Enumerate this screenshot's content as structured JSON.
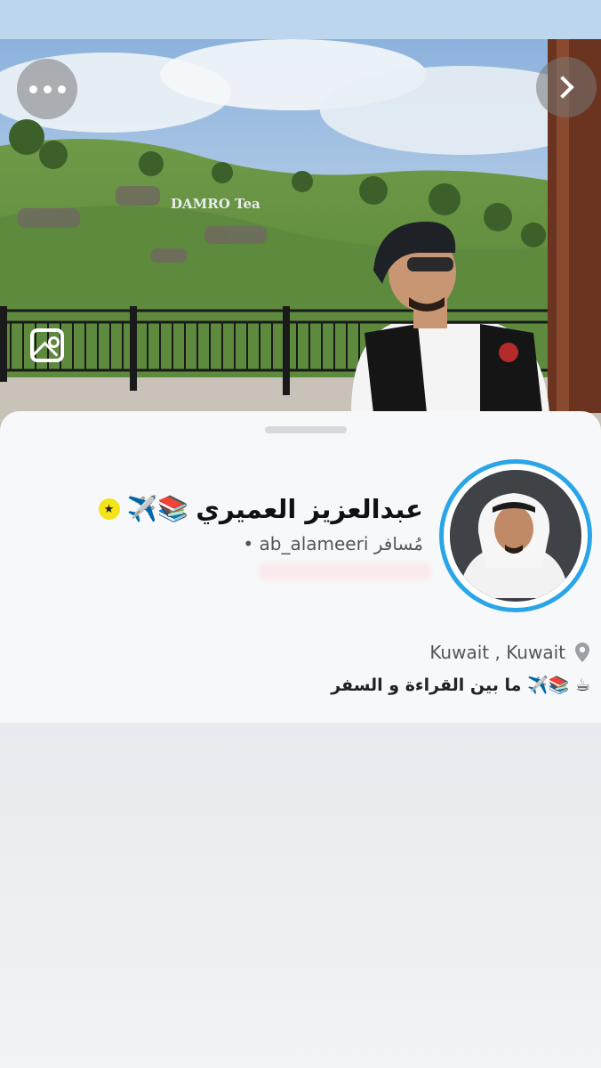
{
  "profile": {
    "display_name": "عبدالعزيز العميري",
    "name_emojis": "✈️📚",
    "star_badge_icon": "★",
    "username_line": "• ab_alameeri مُسافر",
    "location": "Kuwait , Kuwait",
    "bio": "ما بين القراءة و السفر ✈️📚 ☕",
    "banner_sign_text": "DAMRO Tea"
  },
  "icons": {
    "more": "more-horizontal-icon",
    "next": "chevron-right-icon",
    "gallery": "image-gallery-icon",
    "location": "location-pin-icon",
    "badge": "star-badge-icon"
  },
  "colors": {
    "avatar_ring": "#2aa5e8",
    "star_badge": "#f5e419",
    "sheet_background": "#f7f8f9"
  }
}
